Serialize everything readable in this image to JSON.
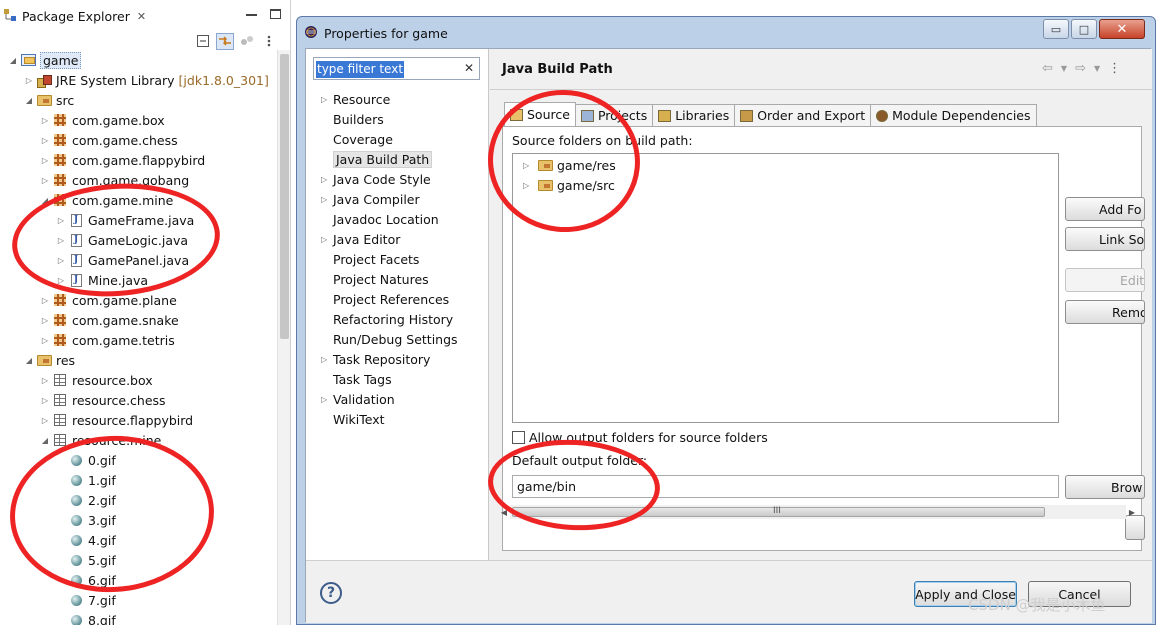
{
  "package_explorer": {
    "title": "Package Explorer",
    "tree": [
      {
        "label": "game",
        "decoration": "",
        "icon": "project",
        "arrow": "open",
        "level": 0,
        "selected": true
      },
      {
        "label": "JRE System Library",
        "decoration": "[jdk1.8.0_301]",
        "icon": "jre",
        "arrow": "closed",
        "level": 1
      },
      {
        "label": "src",
        "decoration": "",
        "icon": "folder",
        "arrow": "open",
        "level": 1
      },
      {
        "label": "com.game.box",
        "decoration": "",
        "icon": "package",
        "arrow": "closed",
        "level": 2
      },
      {
        "label": "com.game.chess",
        "decoration": "",
        "icon": "package",
        "arrow": "closed",
        "level": 2
      },
      {
        "label": "com.game.flappybird",
        "decoration": "",
        "icon": "package",
        "arrow": "closed",
        "level": 2
      },
      {
        "label": "com.game.gobang",
        "decoration": "",
        "icon": "package",
        "arrow": "closed",
        "level": 2
      },
      {
        "label": "com.game.mine",
        "decoration": "",
        "icon": "package",
        "arrow": "open",
        "level": 2
      },
      {
        "label": "GameFrame.java",
        "decoration": "",
        "icon": "java",
        "arrow": "closed",
        "level": 3
      },
      {
        "label": "GameLogic.java",
        "decoration": "",
        "icon": "java",
        "arrow": "closed",
        "level": 3
      },
      {
        "label": "GamePanel.java",
        "decoration": "",
        "icon": "java",
        "arrow": "closed",
        "level": 3
      },
      {
        "label": "Mine.java",
        "decoration": "",
        "icon": "java",
        "arrow": "closed",
        "level": 3
      },
      {
        "label": "com.game.plane",
        "decoration": "",
        "icon": "package",
        "arrow": "closed",
        "level": 2
      },
      {
        "label": "com.game.snake",
        "decoration": "",
        "icon": "package",
        "arrow": "closed",
        "level": 2
      },
      {
        "label": "com.game.tetris",
        "decoration": "",
        "icon": "package",
        "arrow": "closed",
        "level": 2
      },
      {
        "label": "res",
        "decoration": "",
        "icon": "folder",
        "arrow": "open",
        "level": 1
      },
      {
        "label": "resource.box",
        "decoration": "",
        "icon": "respackage",
        "arrow": "closed",
        "level": 2
      },
      {
        "label": "resource.chess",
        "decoration": "",
        "icon": "respackage",
        "arrow": "closed",
        "level": 2
      },
      {
        "label": "resource.flappybird",
        "decoration": "",
        "icon": "respackage",
        "arrow": "closed",
        "level": 2
      },
      {
        "label": "resource.mine",
        "decoration": "",
        "icon": "respackage",
        "arrow": "open",
        "level": 2
      },
      {
        "label": "0.gif",
        "decoration": "",
        "icon": "gif",
        "arrow": "none",
        "level": 3
      },
      {
        "label": "1.gif",
        "decoration": "",
        "icon": "gif",
        "arrow": "none",
        "level": 3
      },
      {
        "label": "2.gif",
        "decoration": "",
        "icon": "gif",
        "arrow": "none",
        "level": 3
      },
      {
        "label": "3.gif",
        "decoration": "",
        "icon": "gif",
        "arrow": "none",
        "level": 3
      },
      {
        "label": "4.gif",
        "decoration": "",
        "icon": "gif",
        "arrow": "none",
        "level": 3
      },
      {
        "label": "5.gif",
        "decoration": "",
        "icon": "gif",
        "arrow": "none",
        "level": 3
      },
      {
        "label": "6.gif",
        "decoration": "",
        "icon": "gif",
        "arrow": "none",
        "level": 3
      },
      {
        "label": "7.gif",
        "decoration": "",
        "icon": "gif",
        "arrow": "none",
        "level": 3
      },
      {
        "label": "8.gif",
        "decoration": "",
        "icon": "gif",
        "arrow": "none",
        "level": 3
      }
    ]
  },
  "dialog": {
    "title": "Properties for game",
    "window_buttons": {
      "minimize": "▭",
      "maximize": "□",
      "close": "✕"
    },
    "filter": {
      "placeholder": "type filter text",
      "clear": "✕"
    },
    "nav": [
      {
        "label": "Resource",
        "arrow": true
      },
      {
        "label": "Builders",
        "arrow": false
      },
      {
        "label": "Coverage",
        "arrow": false
      },
      {
        "label": "Java Build Path",
        "arrow": false,
        "selected": true
      },
      {
        "label": "Java Code Style",
        "arrow": true
      },
      {
        "label": "Java Compiler",
        "arrow": true
      },
      {
        "label": "Javadoc Location",
        "arrow": false
      },
      {
        "label": "Java Editor",
        "arrow": true
      },
      {
        "label": "Project Facets",
        "arrow": false
      },
      {
        "label": "Project Natures",
        "arrow": false
      },
      {
        "label": "Project References",
        "arrow": false
      },
      {
        "label": "Refactoring History",
        "arrow": false
      },
      {
        "label": "Run/Debug Settings",
        "arrow": false
      },
      {
        "label": "Task Repository",
        "arrow": true
      },
      {
        "label": "Task Tags",
        "arrow": false
      },
      {
        "label": "Validation",
        "arrow": true
      },
      {
        "label": "WikiText",
        "arrow": false
      }
    ],
    "page_title": "Java Build Path",
    "tabs": [
      {
        "label": "Source",
        "icon": "folder-icon",
        "active": true
      },
      {
        "label": "Projects",
        "icon": "projects-icon"
      },
      {
        "label": "Libraries",
        "icon": "libraries-icon"
      },
      {
        "label": "Order and Export",
        "icon": "order-icon"
      },
      {
        "label": "Module Dependencies",
        "icon": "module-icon"
      }
    ],
    "source_label": "Source folders on build path:",
    "source_folders": [
      "game/res",
      "game/src"
    ],
    "side_buttons": [
      {
        "label": "Add Fo",
        "disabled": false
      },
      {
        "label": "Link So",
        "disabled": false
      },
      {
        "label": "Edit",
        "disabled": true
      },
      {
        "label": "Remo",
        "disabled": false
      }
    ],
    "allow_output_label": "Allow output folders for source folders",
    "allow_output_checked": false,
    "output_label": "Default output folder:",
    "output_value": "game/bin",
    "browse_label": "Brow",
    "scroll_grip": "III",
    "help": "?",
    "apply_label": "Apply and Close",
    "cancel_label": "Cancel"
  },
  "colors": {
    "annotation": "#ee2424",
    "selection": "#3a78d6"
  },
  "watermark": "CSDN @我是小木鱼"
}
